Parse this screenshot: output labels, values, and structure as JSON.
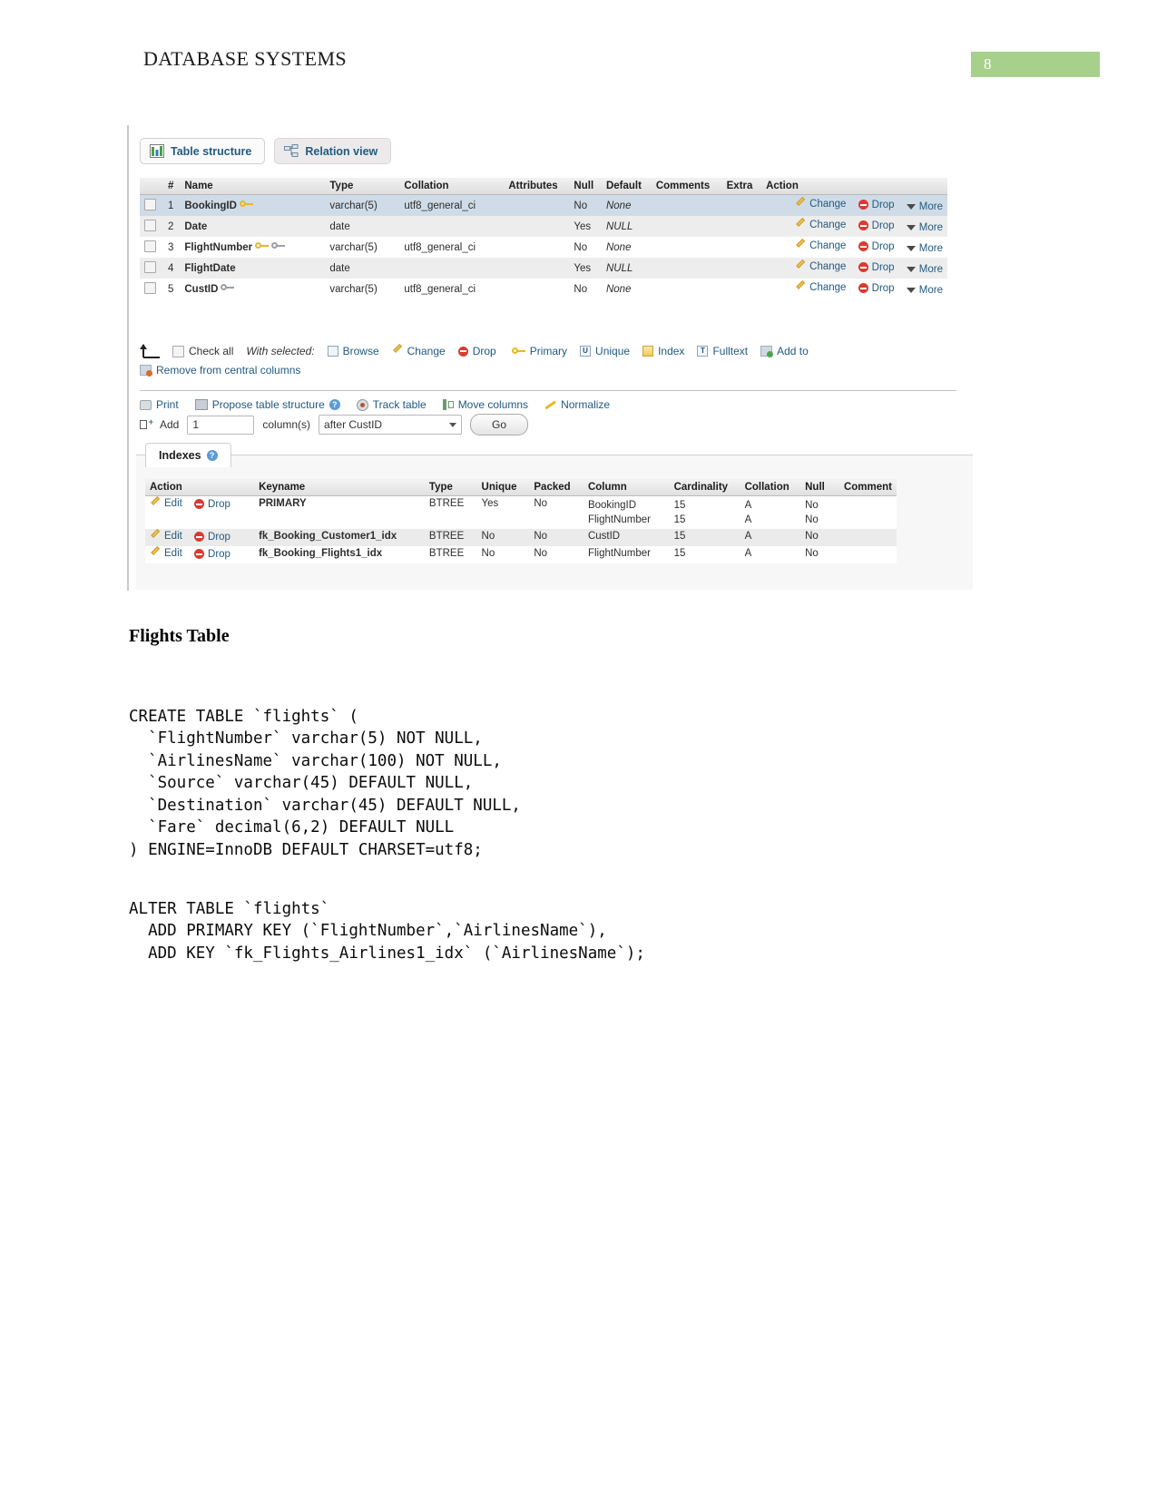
{
  "document": {
    "header_title": "DATABASE SYSTEMS",
    "page_number": "8"
  },
  "pma": {
    "tabs": [
      {
        "label": "Table structure",
        "icon": "table-structure-icon"
      },
      {
        "label": "Relation view",
        "icon": "relation-view-icon"
      }
    ],
    "structure": {
      "headers": [
        "#",
        "Name",
        "Type",
        "Collation",
        "Attributes",
        "Null",
        "Default",
        "Comments",
        "Extra",
        "Action"
      ],
      "rows": [
        {
          "num": "1",
          "name": "BookingID",
          "keys": [
            "primary"
          ],
          "type": "varchar(5)",
          "collation": "utf8_general_ci",
          "attributes": "",
          "null": "No",
          "default": "None",
          "comments": "",
          "extra": "",
          "actions": [
            "Change",
            "Drop",
            "More"
          ]
        },
        {
          "num": "2",
          "name": "Date",
          "keys": [],
          "type": "date",
          "collation": "",
          "attributes": "",
          "null": "Yes",
          "default": "NULL",
          "comments": "",
          "extra": "",
          "actions": [
            "Change",
            "Drop",
            "More"
          ]
        },
        {
          "num": "3",
          "name": "FlightNumber",
          "keys": [
            "primary",
            "index"
          ],
          "type": "varchar(5)",
          "collation": "utf8_general_ci",
          "attributes": "",
          "null": "No",
          "default": "None",
          "comments": "",
          "extra": "",
          "actions": [
            "Change",
            "Drop",
            "More"
          ]
        },
        {
          "num": "4",
          "name": "FlightDate",
          "keys": [],
          "type": "date",
          "collation": "",
          "attributes": "",
          "null": "Yes",
          "default": "NULL",
          "comments": "",
          "extra": "",
          "actions": [
            "Change",
            "Drop",
            "More"
          ]
        },
        {
          "num": "5",
          "name": "CustID",
          "keys": [
            "index"
          ],
          "type": "varchar(5)",
          "collation": "utf8_general_ci",
          "attributes": "",
          "null": "No",
          "default": "None",
          "comments": "",
          "extra": "",
          "actions": [
            "Change",
            "Drop",
            "More"
          ]
        }
      ]
    },
    "with_selected": {
      "check_all": "Check all",
      "label": "With selected:",
      "actions": [
        {
          "label": "Browse",
          "icon": "browse-icon"
        },
        {
          "label": "Change",
          "icon": "pencil-icon"
        },
        {
          "label": "Drop",
          "icon": "drop-icon"
        },
        {
          "label": "Primary",
          "icon": "key-icon"
        },
        {
          "label": "Unique",
          "icon": "unique-icon"
        },
        {
          "label": "Index",
          "icon": "index-icon"
        },
        {
          "label": "Fulltext",
          "icon": "fulltext-icon"
        },
        {
          "label": "Add to",
          "icon": "add-to-central-columns-icon"
        }
      ],
      "remove_central": "Remove from central columns"
    },
    "operations": [
      {
        "label": "Print",
        "icon": "printer-icon"
      },
      {
        "label": "Propose table structure",
        "icon": "propose-icon"
      },
      {
        "label": "Track table",
        "icon": "eye-icon"
      },
      {
        "label": "Move columns",
        "icon": "move-columns-icon"
      },
      {
        "label": "Normalize",
        "icon": "wand-icon"
      }
    ],
    "add_column": {
      "label": "Add",
      "count": "1",
      "unit": "column(s)",
      "position": "after CustID",
      "go": "Go"
    },
    "indexes": {
      "title": "Indexes",
      "headers": [
        "Action",
        "Keyname",
        "Type",
        "Unique",
        "Packed",
        "Column",
        "Cardinality",
        "Collation",
        "Null",
        "Comment"
      ],
      "rows": [
        {
          "edit": "Edit",
          "drop": "Drop",
          "keyname": "PRIMARY",
          "type": "BTREE",
          "unique": "Yes",
          "packed": "No",
          "columns": [
            "BookingID",
            "FlightNumber"
          ],
          "cardinality": [
            "15",
            "15"
          ],
          "collation": [
            "A",
            "A"
          ],
          "nulls": [
            "No",
            "No"
          ],
          "comment": ""
        },
        {
          "edit": "Edit",
          "drop": "Drop",
          "keyname": "fk_Booking_Customer1_idx",
          "type": "BTREE",
          "unique": "No",
          "packed": "No",
          "columns": [
            "CustID"
          ],
          "cardinality": [
            "15"
          ],
          "collation": [
            "A"
          ],
          "nulls": [
            "No"
          ],
          "comment": ""
        },
        {
          "edit": "Edit",
          "drop": "Drop",
          "keyname": "fk_Booking_Flights1_idx",
          "type": "BTREE",
          "unique": "No",
          "packed": "No",
          "columns": [
            "FlightNumber"
          ],
          "cardinality": [
            "15"
          ],
          "collation": [
            "A"
          ],
          "nulls": [
            "No"
          ],
          "comment": ""
        }
      ]
    }
  },
  "section": {
    "heading": "Flights Table",
    "sql_create": "CREATE TABLE `flights` (\n  `FlightNumber` varchar(5) NOT NULL,\n  `AirlinesName` varchar(100) NOT NULL,\n  `Source` varchar(45) DEFAULT NULL,\n  `Destination` varchar(45) DEFAULT NULL,\n  `Fare` decimal(6,2) DEFAULT NULL\n) ENGINE=InnoDB DEFAULT CHARSET=utf8;",
    "sql_alter": "ALTER TABLE `flights`\n  ADD PRIMARY KEY (`FlightNumber`,`AirlinesName`),\n  ADD KEY `fk_Flights_Airlines1_idx` (`AirlinesName`);"
  },
  "colors": {
    "page_badge": "#a8d08d",
    "link": "#235a81",
    "highlight_row": "#cfdce8"
  }
}
